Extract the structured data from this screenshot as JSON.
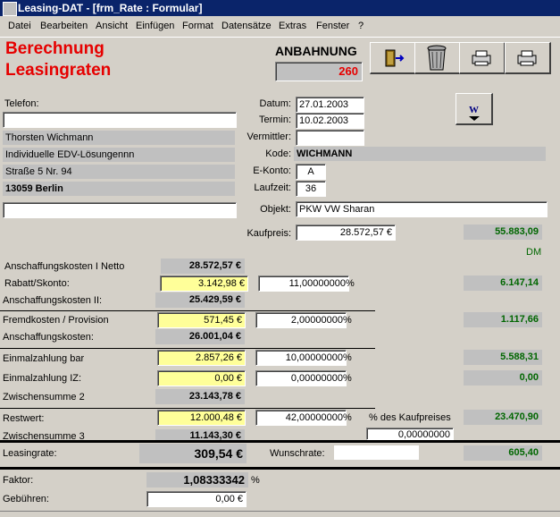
{
  "window": {
    "title": "Leasing-DAT - [frm_Rate : Formular]"
  },
  "menu": [
    "Datei",
    "Bearbeiten",
    "Ansicht",
    "Einfügen",
    "Format",
    "Datensätze",
    "Extras",
    "Fenster",
    "?"
  ],
  "header": {
    "title_line1": "Berechnung",
    "title_line2": "Leasingraten",
    "status_label": "ANBAHNUNG",
    "status_number": "260"
  },
  "toolbar": [
    {
      "name": "exit-button",
      "icon": "door-exit-icon"
    },
    {
      "name": "delete-button",
      "icon": "trash-can-icon"
    },
    {
      "name": "print-button",
      "icon": "printer-icon"
    },
    {
      "name": "print2-button",
      "icon": "printer-icon"
    }
  ],
  "word_button": {
    "icon": "word-document-icon"
  },
  "contact": {
    "telefon_label": "Telefon:",
    "telefon_value": "",
    "name": "Thorsten Wichmann",
    "company": "Individuelle EDV-Lösungennn",
    "street": "Straße 5 Nr. 94",
    "city": "13059 Berlin",
    "extra": ""
  },
  "fields": {
    "datum_label": "Datum:",
    "datum": "27.01.2003",
    "termin_label": "Termin:",
    "termin": "10.02.2003",
    "vermittler_label": "Vermittler:",
    "vermittler": "",
    "kode_label": "Kode:",
    "kode": "WICHMANN",
    "ekonto_label": "E-Konto:",
    "ekonto": "A",
    "laufzeit_label": "Laufzeit:",
    "laufzeit": "36",
    "objekt_label": "Objekt:",
    "objekt": "PKW VW Sharan",
    "kaufpreis_label": "Kaufpreis:",
    "kaufpreis": "28.572,57 €",
    "kaufpreis_dm": "55.883,09",
    "dm_label": "DM"
  },
  "calc": {
    "ak_netto_label": "Anschaffungskosten I Netto",
    "ak_netto": "28.572,57 €",
    "rabatt_label": "Rabatt/Skonto:",
    "rabatt": "3.142,98 €",
    "rabatt_pct": "11,00000000",
    "rabatt_dm": "6.147,14",
    "ak2_label": "Anschaffungskosten II:",
    "ak2": "25.429,59 €",
    "fremd_label": "Fremdkosten / Provision",
    "fremd": "571,45 €",
    "fremd_pct": "2,00000000",
    "fremd_dm": "1.117,66",
    "ak_label": "Anschaffungskosten:",
    "ak": "26.001,04 €",
    "ez_bar_label": "Einmalzahlung bar",
    "ez_bar": "2.857,26 €",
    "ez_bar_pct": "10,00000000",
    "ez_bar_dm": "5.588,31",
    "ez_iz_label": "Einmalzahlung IZ:",
    "ez_iz": "0,00 €",
    "ez_iz_pct": "0,00000000",
    "ez_iz_dm": "0,00",
    "zs2_label": "Zwischensumme 2",
    "zs2": "23.143,78 €",
    "restwert_label": "Restwert:",
    "restwert": "12.000,48 €",
    "restwert_pct": "42,00000000",
    "restwert_note": "% des Kaufpreises",
    "restwert_dm": "23.470,90",
    "zs3_label": "Zwischensumme 3",
    "zs3": "11.143,30 €",
    "zs3_extra": "0,00000000",
    "pct_sign": "%"
  },
  "result": {
    "leasingrate_label": "Leasingrate:",
    "leasingrate": "309,54 €",
    "wunschrate_label": "Wunschrate:",
    "wunschrate": "",
    "leasingrate_dm": "605,40",
    "faktor_label": "Faktor:",
    "faktor": "1,08333342",
    "faktor_pct": "%",
    "gebuehren_label": "Gebühren:",
    "gebuehren": "0,00 €"
  },
  "colors": {
    "title_red": "#e60000",
    "dm_green": "#006600",
    "input_yellow": "#ffff99",
    "titlebar_blue": "#0a246a"
  }
}
